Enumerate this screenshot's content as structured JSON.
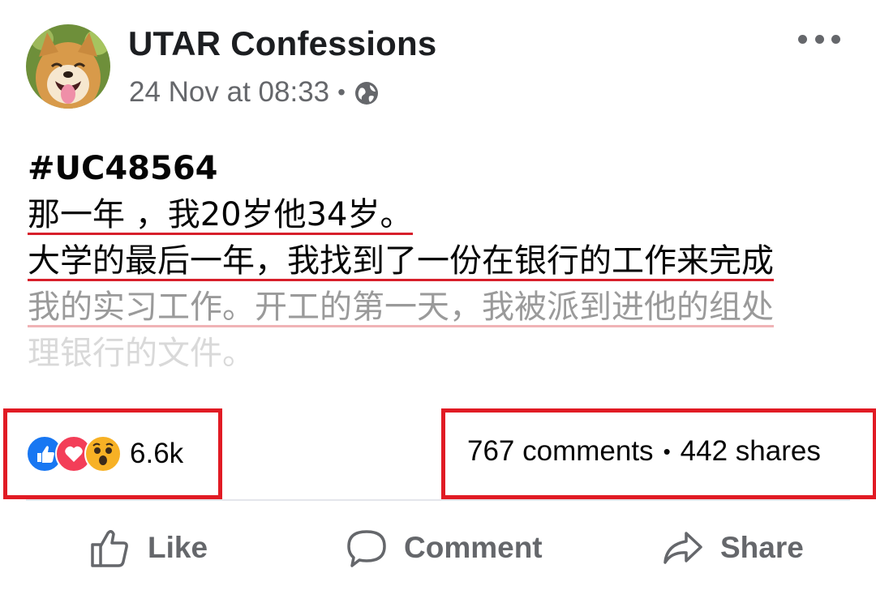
{
  "post": {
    "page_name": "UTAR Confessions",
    "timestamp": "24 Nov at 08:33",
    "separator": "•",
    "audience_icon": "globe-icon",
    "tag": "#UC48564",
    "lines": [
      "那一年 ，我20岁他34岁。",
      "大学的最后一年，我找到了一份在银行的工作来完成",
      "我的实习工作。开工的第一天，我被派到进他的组处",
      "理银行的文件。"
    ]
  },
  "engagement": {
    "reaction_icons": [
      "like-reaction-icon",
      "love-reaction-icon",
      "wow-reaction-icon"
    ],
    "reaction_count": "6.6k",
    "comments": "767 comments",
    "dot": "•",
    "shares": "442 shares"
  },
  "actions": {
    "like": "Like",
    "comment": "Comment",
    "share": "Share"
  },
  "colors": {
    "highlight_box": "#e11b24",
    "underline": "#d71f2b",
    "secondary_text": "#65676b",
    "like_blue": "#1877f2",
    "love_red": "#f33e58",
    "wow_yellow": "#f7b125"
  }
}
